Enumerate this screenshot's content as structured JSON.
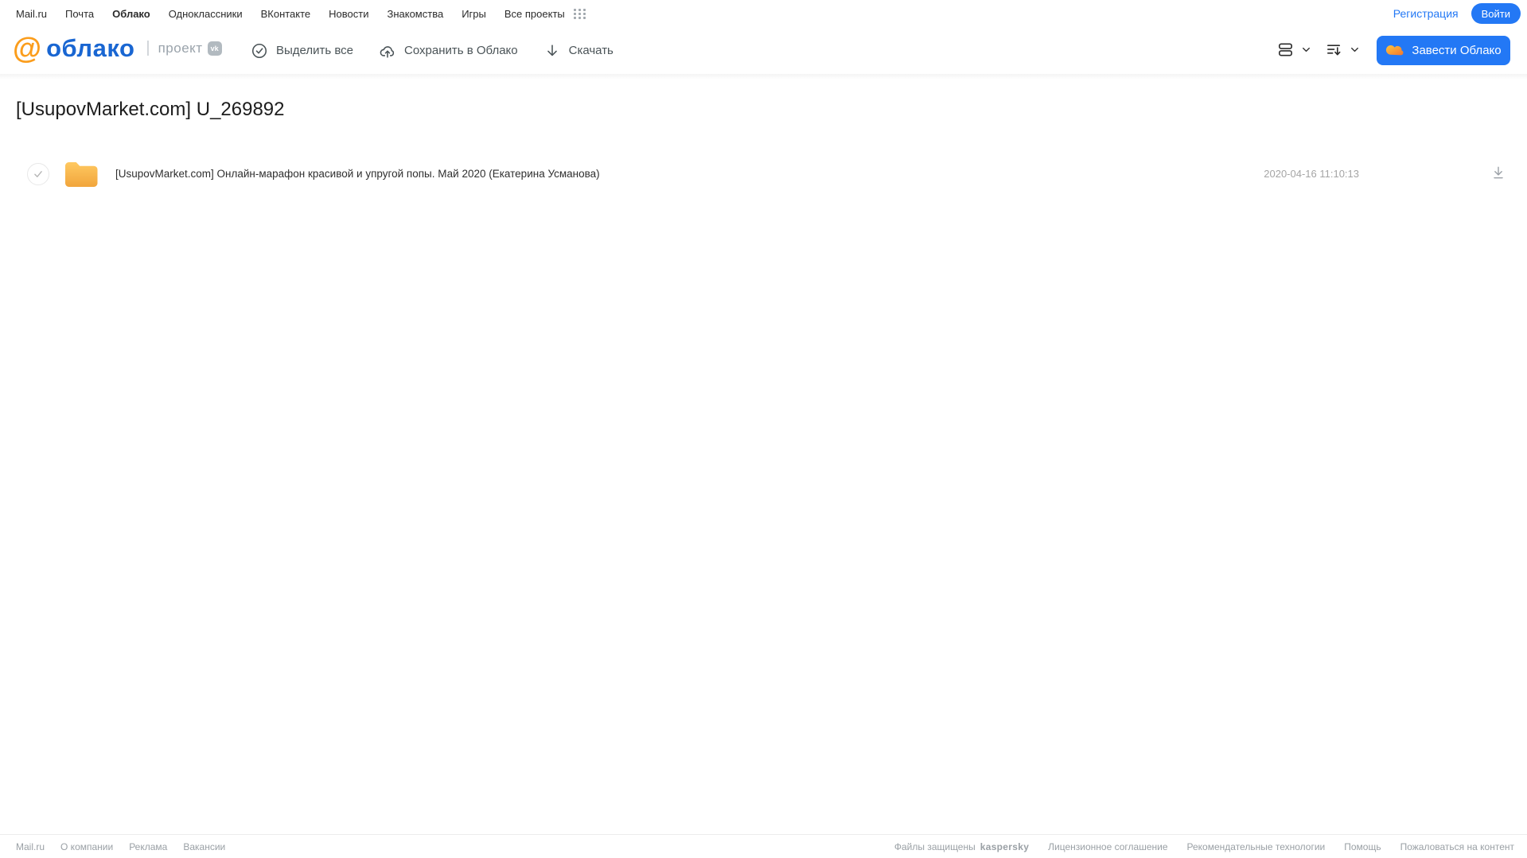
{
  "topnav": {
    "items": [
      "Mail.ru",
      "Почта",
      "Облако",
      "Одноклассники",
      "ВКонтакте",
      "Новости",
      "Знакомства",
      "Игры",
      "Все проекты"
    ],
    "registration": "Регистрация",
    "login": "Войти"
  },
  "header": {
    "logo": {
      "at": "@",
      "text": "облако",
      "project": "проект",
      "vk": "vk"
    },
    "actions": {
      "select_all": "Выделить все",
      "save_to_cloud": "Сохранить в Облако",
      "download": "Скачать"
    },
    "create_cloud": "Завести Облако"
  },
  "main": {
    "title": "[UsupovMarket.com] U_269892",
    "files": [
      {
        "type": "folder",
        "name": "[UsupovMarket.com] Онлайн-марафон красивой и упругой попы. Май 2020 (Екатерина Усманова)",
        "modified": "2020-04-16 11:10:13"
      }
    ]
  },
  "footer": {
    "left": [
      "Mail.ru",
      "О компании",
      "Реклама",
      "Вакансии"
    ],
    "protected": "Файлы защищены",
    "kaspersky": "kaspersky",
    "right": [
      "Лицензионное соглашение",
      "Рекомендательные технологии",
      "Помощь",
      "Пожаловаться на контент"
    ]
  },
  "colors": {
    "accent_blue": "#2378f5",
    "logo_blue": "#1966d2",
    "logo_orange": "#fb9d1c",
    "folder_top": "#ffc961",
    "folder_bottom": "#f1a53c",
    "kaspersky_green": "#00736c"
  }
}
